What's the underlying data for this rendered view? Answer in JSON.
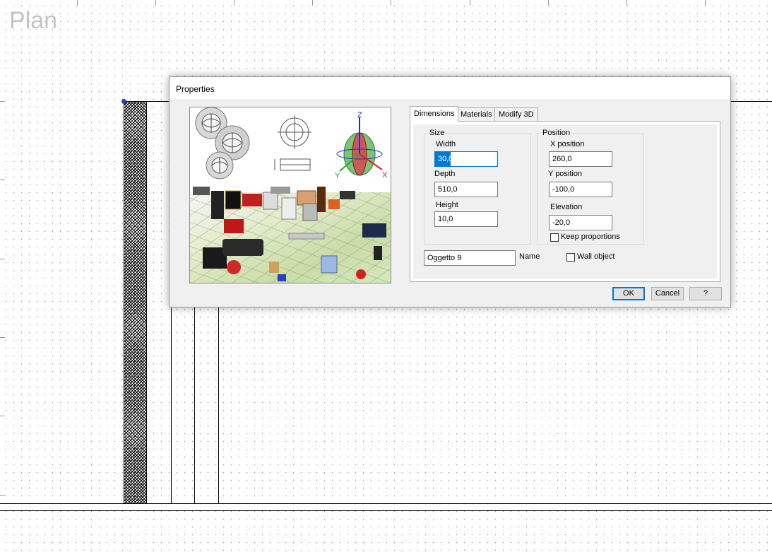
{
  "canvas": {
    "title": "Plan",
    "colors": {
      "accent": "#0078d7",
      "corner_point": "#1e3cd2",
      "axis_x": "#e02020",
      "axis_y": "#20b020",
      "axis_z": "#2030c0"
    }
  },
  "dialog": {
    "title": "Properties",
    "preview": {
      "description_icons": [
        "spheres-icon",
        "gear-schematic-icon",
        "axis-gizmo-icon",
        "furniture-catalog-image"
      ],
      "axis_labels": {
        "z": "Z",
        "y": "Y",
        "x": "X"
      }
    },
    "tabs": [
      {
        "label": "Dimensions",
        "active": true
      },
      {
        "label": "Materials",
        "active": false
      },
      {
        "label": "Modify 3D",
        "active": false
      }
    ],
    "size": {
      "legend": "Size",
      "width_label": "Width",
      "width_value": "30,0",
      "depth_label": "Depth",
      "depth_value": "510,0",
      "height_label": "Height",
      "height_value": "10,0"
    },
    "position": {
      "legend": "Position",
      "x_label": "X position",
      "x_value": "260,0",
      "y_label": "Y position",
      "y_value": "-100,0",
      "elevation_label": "Elevation",
      "elevation_value": "-20,0",
      "keep_proportions_label": "Keep proportions",
      "keep_proportions_checked": false
    },
    "name_value": "Oggetto 9",
    "name_label": "Name",
    "wall_object_label": "Wall object",
    "wall_object_checked": false,
    "buttons": {
      "ok": "OK",
      "cancel": "Cancel",
      "help": "?"
    }
  }
}
